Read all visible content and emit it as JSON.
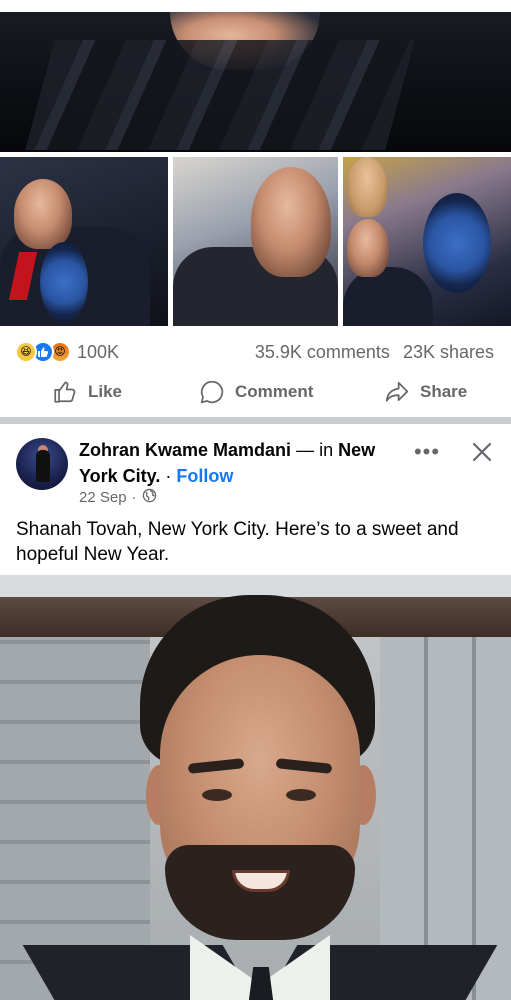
{
  "post1": {
    "images": [
      {
        "alt_icon": "photo-main"
      },
      {
        "alt_icon": "photo-thumb-1"
      },
      {
        "alt_icon": "photo-thumb-2"
      },
      {
        "alt_icon": "photo-thumb-3"
      }
    ],
    "reactions": {
      "icons": [
        "haha-reaction-icon",
        "like-reaction-icon",
        "angry-reaction-icon"
      ],
      "count": "100K"
    },
    "comments_count": "35.9K comments",
    "shares_count": "23K shares",
    "actions": {
      "like_label": "Like",
      "comment_label": "Comment",
      "share_label": "Share"
    }
  },
  "post2": {
    "author_name": "Zohran Kwame Mamdani",
    "in_text": "— in",
    "place": "New York City.",
    "separator": "·",
    "follow_label": "Follow",
    "date": "22 Sep",
    "date_separator": "·",
    "privacy_icon": "globe-icon",
    "more_label": "•••",
    "close_icon": "close-icon",
    "text": "Shanah Tovah, New York City. Here’s to a sweet and hopeful New Year."
  },
  "colors": {
    "accent": "#1877f2",
    "secondary_text": "#65676b",
    "primary_text": "#050505",
    "divider": "#c9ccd1"
  }
}
